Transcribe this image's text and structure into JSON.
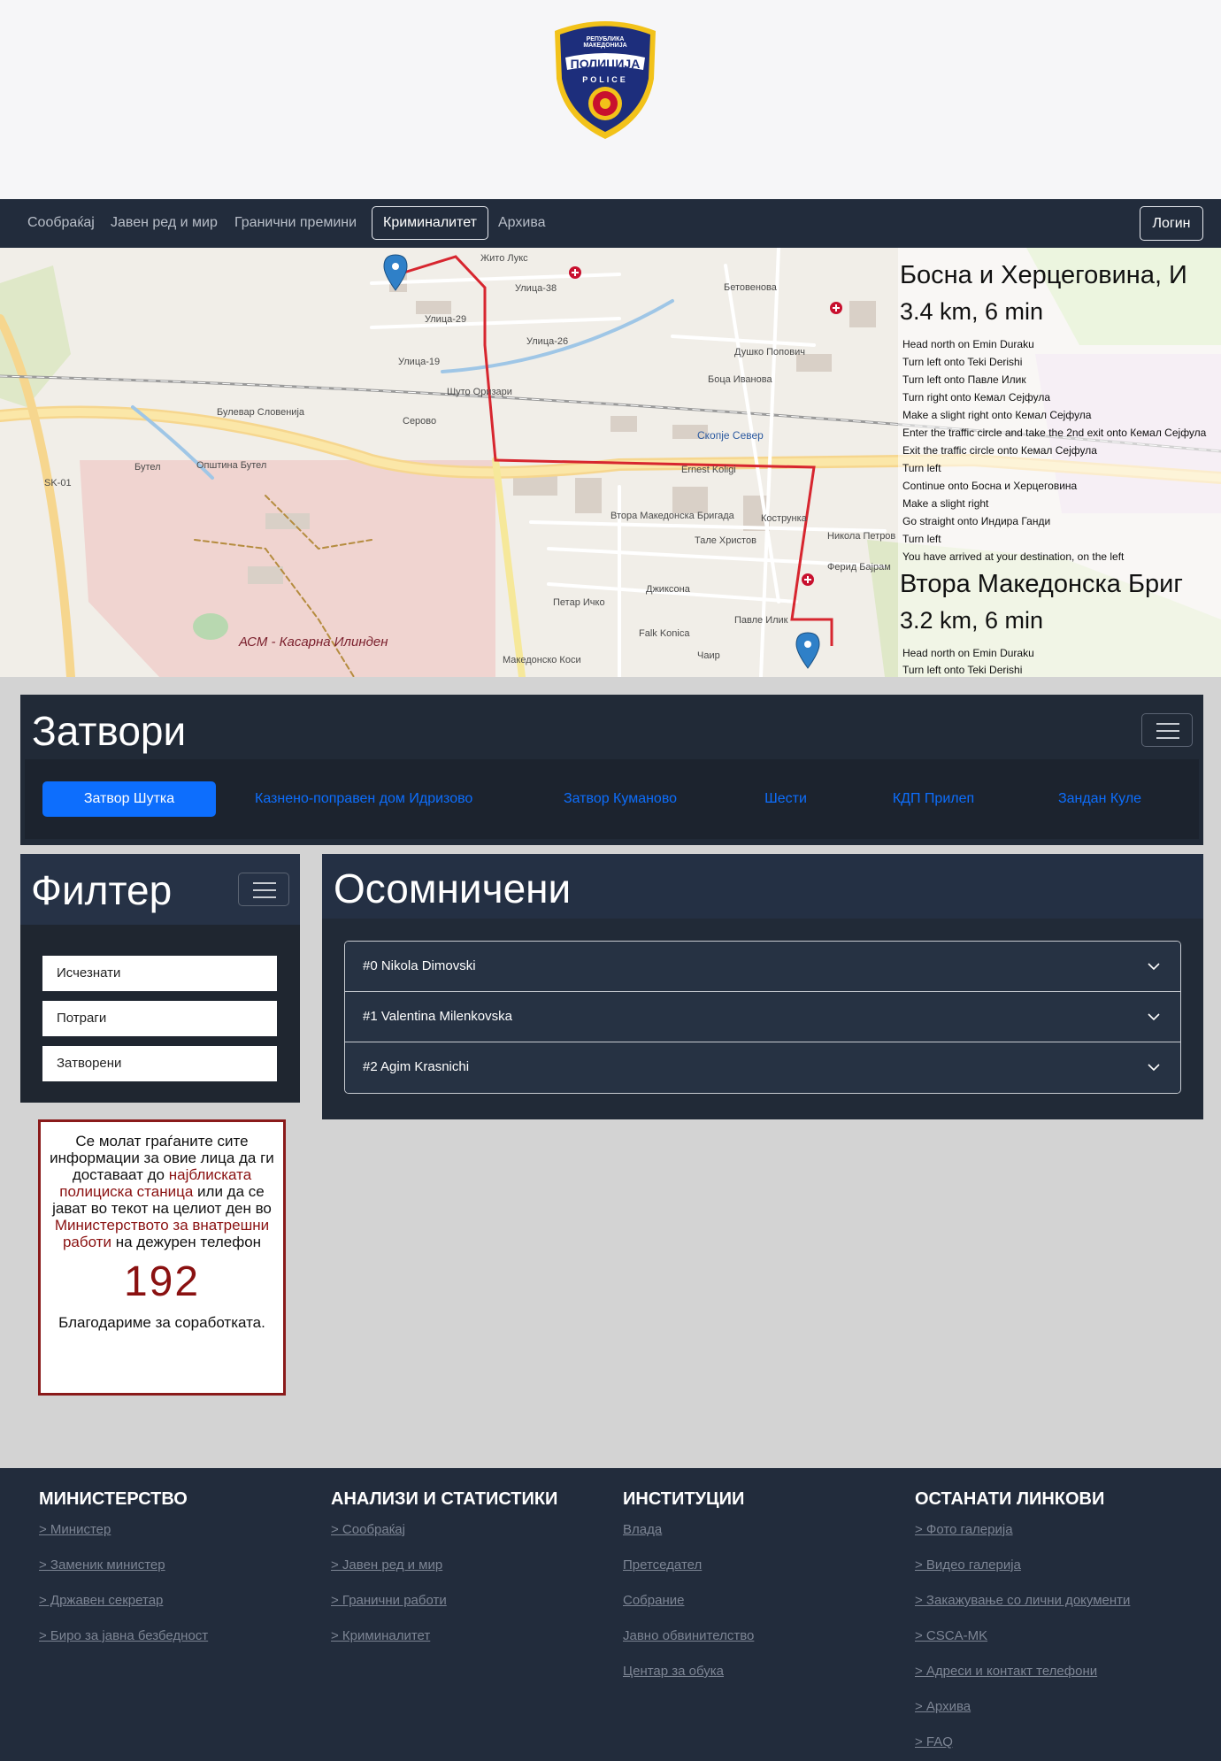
{
  "logo": {
    "top_text": "РЕПУБЛИКА МАКЕДОНИЈА",
    "main_text": "ПОЛИЦИЈА",
    "sub_text": "POLICE"
  },
  "nav": {
    "items": [
      "Сообраќај",
      "Јавен ред и мир",
      "Гранични премини",
      "Криминалитет",
      "Архива"
    ],
    "active": "Криминалитет",
    "login_label": "Логин"
  },
  "map": {
    "labels": [
      "Жито Лукс",
      "Улица-38",
      "Улица-29",
      "Улица-26",
      "Улица-19",
      "Шуто Оризари",
      "Булевар Словенија",
      "Серово",
      "Бутел",
      "Општина Бутел",
      "SK-01",
      "АСМ - Касарна Илинден",
      "Скопје Север",
      "Ernest Koligi",
      "Втора Македонска Бригада",
      "Кострунка",
      "Петар Ичко",
      "Джиксона",
      "Falk Konica",
      "Ферид Бајрам",
      "Павле Илик",
      "Чаир",
      "Боца Иванова",
      "Бетовенова",
      "Душко Попович",
      "Никола Петров",
      "Тале Христов",
      "Македонско Коси"
    ],
    "routes": [
      {
        "title": "Босна и Херцеговина, И",
        "summary": "3.4 km, 6 min",
        "steps": [
          "Head north on Emin Duraku",
          "Turn left onto Teki Derishi",
          "Turn left onto Павле Илик",
          "Turn right onto Кемал Сејфула",
          "Make a slight right onto Кемал Сејфула",
          "Enter the traffic circle and take the 2nd exit onto Кемал Сејфула",
          "Exit the traffic circle onto Кемал Сејфула",
          "Turn left",
          "Continue onto Босна и Херцеговина",
          "Make a slight right",
          "Go straight onto Индира Ганди",
          "Turn left",
          "You have arrived at your destination, on the left"
        ]
      },
      {
        "title": "Втора Македонска Бриг",
        "summary": "3.2 km, 6 min",
        "steps": [
          "Head north on Emin Duraku",
          "Turn left onto Teki Derishi"
        ]
      }
    ]
  },
  "prisons": {
    "title": "Затвори",
    "tabs": [
      "Затвор Шутка",
      "Казнено-поправен дом Идризово",
      "Затвор Куманово",
      "Шести",
      "КДП Прилеп",
      "Зандан Куле"
    ],
    "active_tab": "Затвор Шутка"
  },
  "filter": {
    "title": "Филтер",
    "items": [
      "Исчезнати",
      "Потраги",
      "Затворени"
    ]
  },
  "notice": {
    "line1": "Се молат граѓаните сите информации за овие лица да ги доставаат до",
    "red1": "најблиската полициска станица",
    "line2": "или да се јават во текот на целиот ден во",
    "red2": "Министерството за внатрешни работи",
    "line3": "на дежурен телефон",
    "number": "192",
    "thanks": "Благодариме за соработката."
  },
  "suspects": {
    "title": "Осомничени",
    "items": [
      "#0 Nikola Dimovski",
      "#1 Valentina Milenkovska",
      "#2 Agim Krasnichi"
    ]
  },
  "footer": {
    "columns": [
      {
        "heading": "МИНИСТЕРСТВО",
        "links": [
          "> Министер",
          "> Заменик министер",
          "> Државен секретар",
          "> Биро за јавна безбедност"
        ]
      },
      {
        "heading": "АНАЛИЗИ И СТАТИСТИКИ",
        "links": [
          "> Сообраќај",
          "> Јавен ред и мир",
          "> Гранични работи",
          "> Криминалитет"
        ]
      },
      {
        "heading": "ИНСТИТУЦИИ",
        "links": [
          "Влада",
          "Претседател",
          "Собрание",
          "Јавно обвинителство",
          "Центар за обука"
        ]
      },
      {
        "heading": "ОСТАНАТИ ЛИНКОВИ",
        "links": [
          "> Фото галерија",
          "> Видео галерија",
          "> Закажување со лични документи",
          "> CSCA-MK",
          "> Адреси и контакт телефони",
          "> Архива",
          "> FAQ"
        ]
      }
    ]
  },
  "colors": {
    "navbar": "#222c3c",
    "primary": "#0d6efd",
    "route": "#d7262f",
    "notice_red": "#8a1111"
  }
}
